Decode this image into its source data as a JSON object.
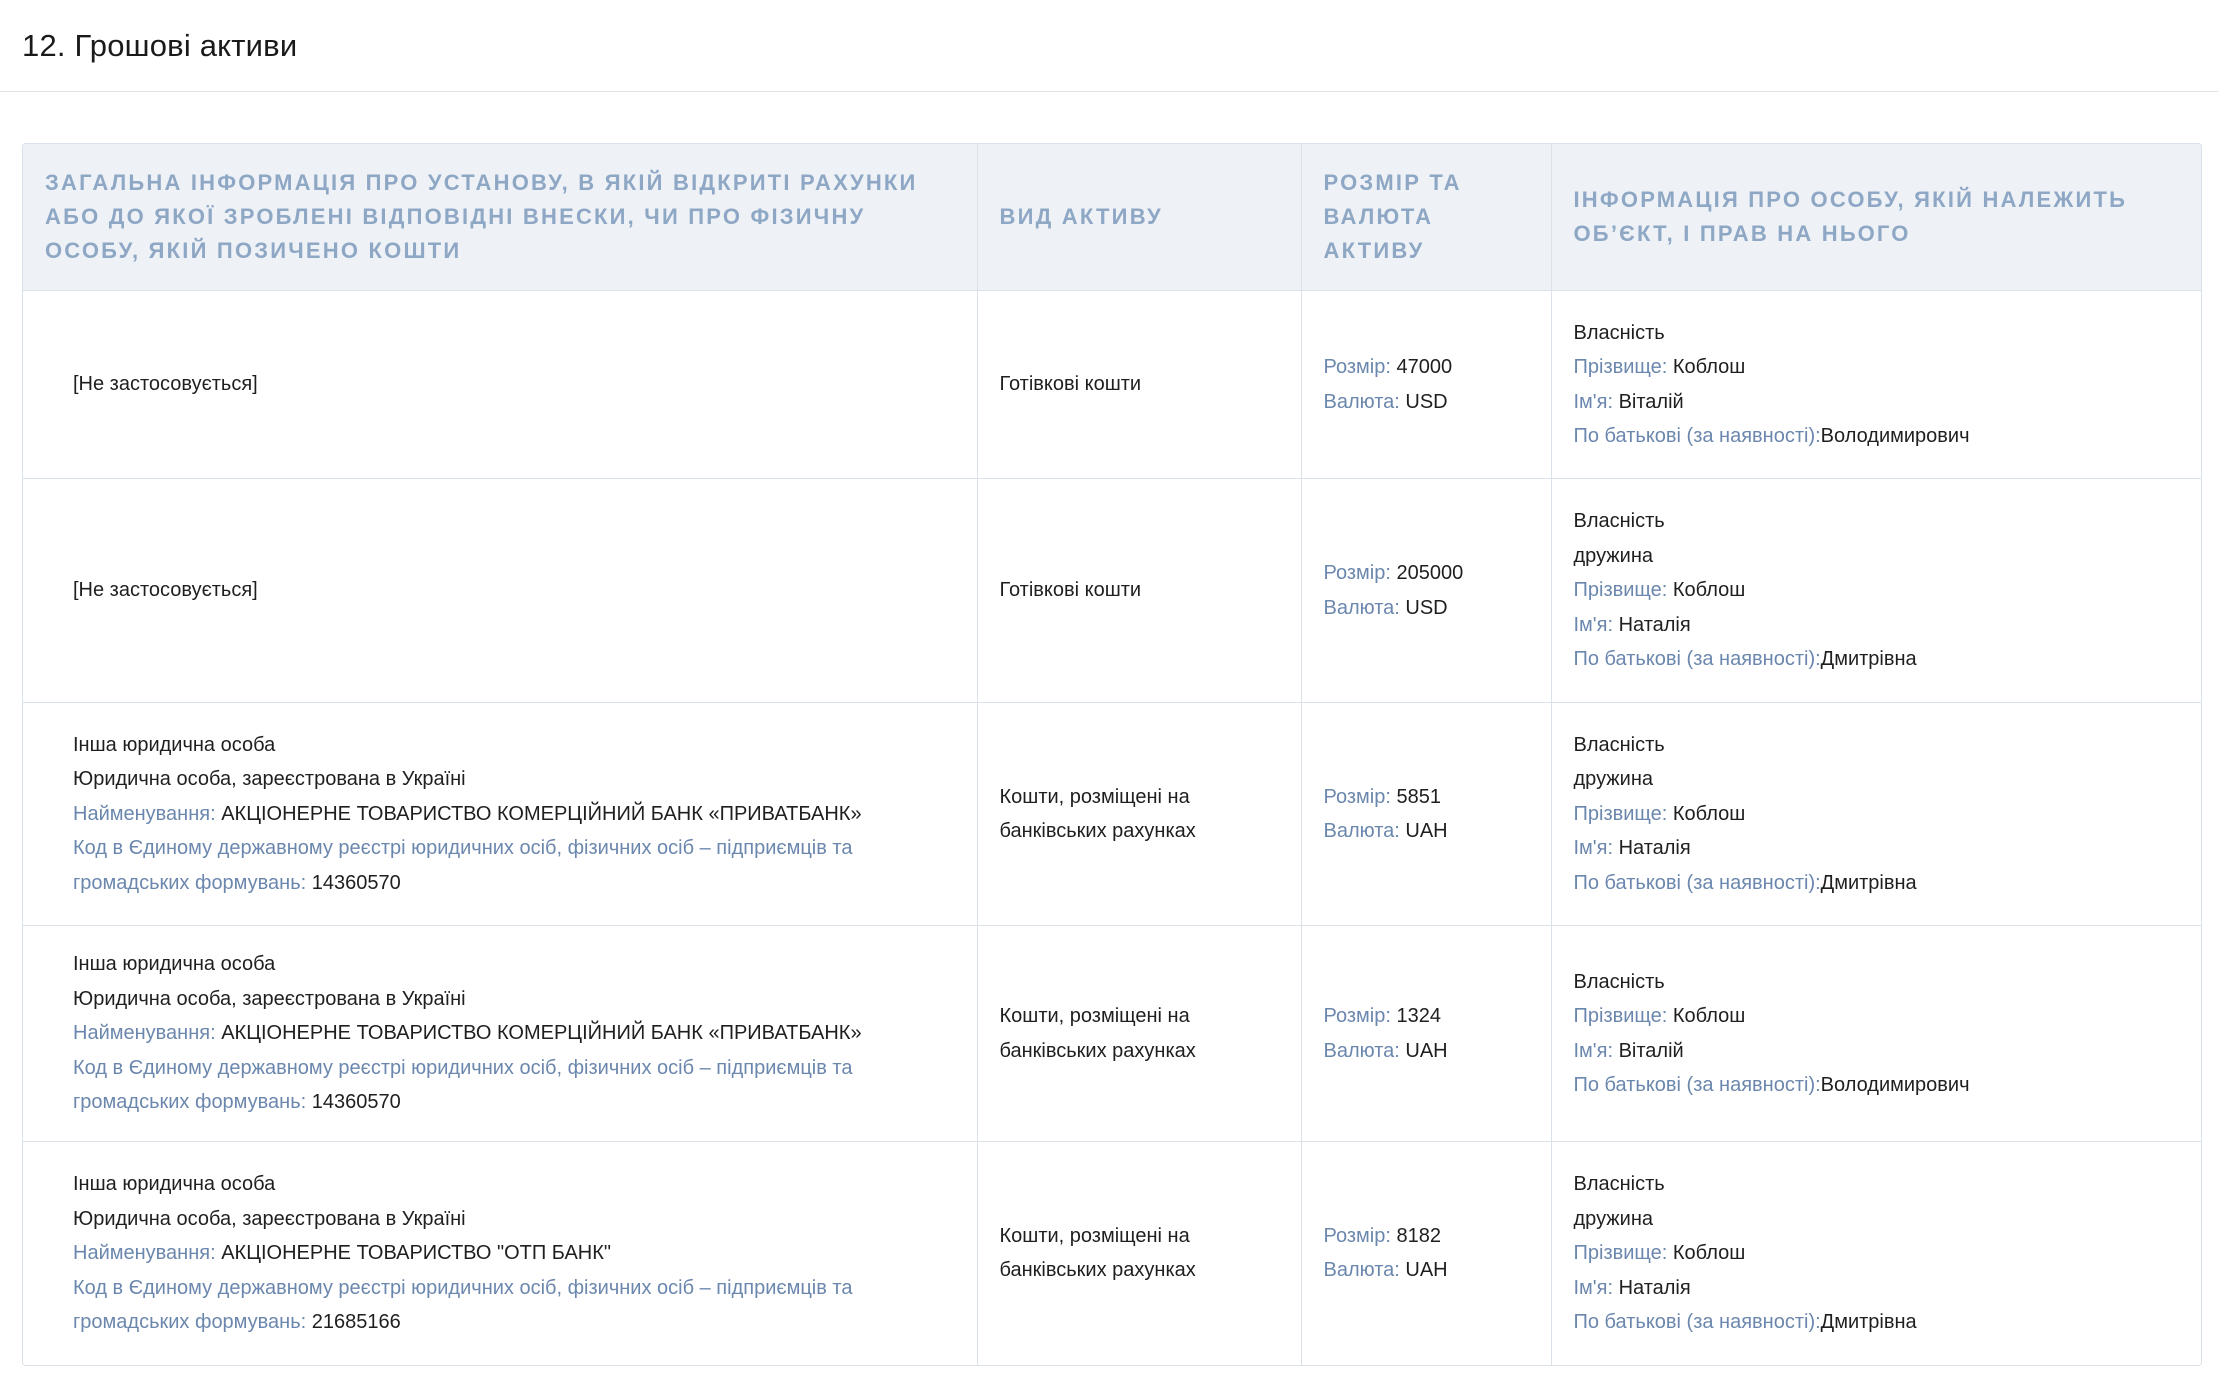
{
  "section": {
    "title": "12. Грошові активи"
  },
  "table": {
    "headers": [
      "Загальна інформація про установу, в якій відкриті рахунки або до якої зроблені відповідні внески, чи про фізичну особу, якій позичено кошти",
      "Вид активу",
      "Розмір та валюта активу",
      "Інформація про особу, якій належить об’єкт, і прав на нього"
    ],
    "labels": {
      "name": "Найменування:",
      "code": "Код в Єдиному державному реєстрі юридичних осіб, фізичних осіб – підприємців та громадських формувань:",
      "size": "Розмір:",
      "currency": "Валюта:",
      "surname": "Прізвище:",
      "first_name": "Ім'я:",
      "patronymic": "По батькові (за наявності):"
    },
    "rows": [
      {
        "institution": {
          "not_applicable": "[Не застосовується]"
        },
        "asset_type": "Готівкові кошти",
        "size": "47000",
        "currency": "USD",
        "owner": {
          "right": "Власність",
          "relation": "",
          "surname": "Коблош",
          "first_name": "Віталій",
          "patronymic": "Володимирович"
        }
      },
      {
        "institution": {
          "not_applicable": "[Не застосовується]"
        },
        "asset_type": "Готівкові кошти",
        "size": "205000",
        "currency": "USD",
        "owner": {
          "right": "Власність",
          "relation": "дружина",
          "surname": "Коблош",
          "first_name": "Наталія",
          "patronymic": "Дмитрівна"
        }
      },
      {
        "institution": {
          "kind": "Інша юридична особа",
          "registration": "Юридична особа, зареєстрована в Україні",
          "name": "АКЦІОНЕРНЕ ТОВАРИСТВО КОМЕРЦІЙНИЙ БАНК «ПРИВАТБАНК»",
          "code": "14360570"
        },
        "asset_type": "Кошти, розміщені на банківських рахунках",
        "size": "5851",
        "currency": "UAH",
        "owner": {
          "right": "Власність",
          "relation": "дружина",
          "surname": "Коблош",
          "first_name": "Наталія",
          "patronymic": "Дмитрівна"
        }
      },
      {
        "institution": {
          "kind": "Інша юридична особа",
          "registration": "Юридична особа, зареєстрована в Україні",
          "name": "АКЦІОНЕРНЕ ТОВАРИСТВО КОМЕРЦІЙНИЙ БАНК «ПРИВАТБАНК»",
          "code": "14360570"
        },
        "asset_type": "Кошти, розміщені на банківських рахунках",
        "size": "1324",
        "currency": "UAH",
        "owner": {
          "right": "Власність",
          "relation": "",
          "surname": "Коблош",
          "first_name": "Віталій",
          "patronymic": "Володимирович"
        }
      },
      {
        "institution": {
          "kind": "Інша юридична особа",
          "registration": "Юридична особа, зареєстрована в Україні",
          "name": "АКЦІОНЕРНЕ ТОВАРИСТВО \"ОТП БАНК\"",
          "code": "21685166"
        },
        "asset_type": "Кошти, розміщені на банківських рахунках",
        "size": "8182",
        "currency": "UAH",
        "owner": {
          "right": "Власність",
          "relation": "дружина",
          "surname": "Коблош",
          "first_name": "Наталія",
          "patronymic": "Дмитрівна"
        }
      }
    ]
  }
}
